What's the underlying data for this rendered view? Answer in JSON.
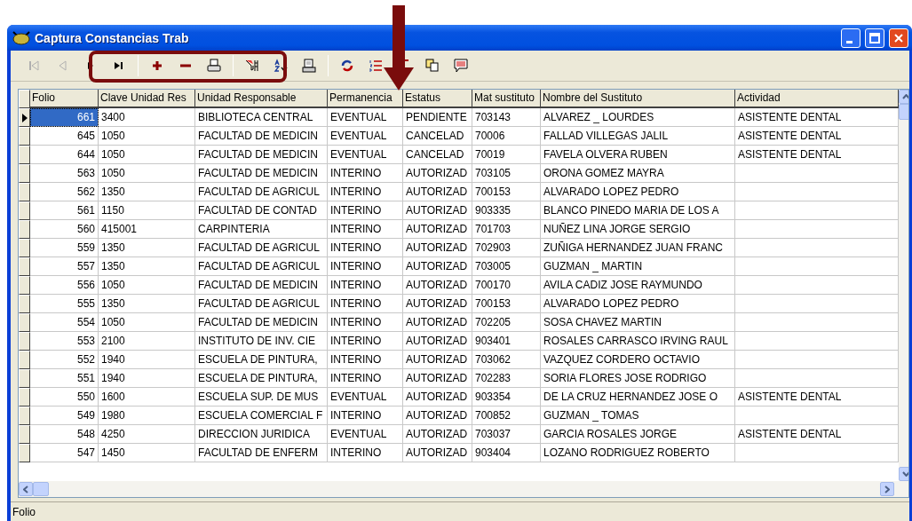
{
  "window": {
    "title": "Captura Constancias Trab"
  },
  "toolbar": [
    {
      "kind": "first",
      "disabled": true
    },
    {
      "kind": "prev",
      "disabled": true
    },
    {
      "kind": "next"
    },
    {
      "kind": "last"
    },
    {
      "kind": "separator"
    },
    {
      "kind": "add"
    },
    {
      "kind": "remove"
    },
    {
      "kind": "print"
    },
    {
      "kind": "separator"
    },
    {
      "kind": "filter"
    },
    {
      "kind": "sort"
    },
    {
      "kind": "preview"
    },
    {
      "kind": "separator"
    },
    {
      "kind": "refresh"
    },
    {
      "kind": "list"
    },
    {
      "kind": "sum"
    },
    {
      "kind": "copy"
    },
    {
      "kind": "comment"
    }
  ],
  "table": {
    "columns": [
      "Folio",
      "Clave Unidad Res",
      "Unidad Responsable",
      "Permanencia",
      "Estatus",
      "Mat sustituto",
      "Nombre del Sustituto",
      "Actividad"
    ],
    "rows": [
      {
        "selected": true,
        "cells": [
          "661",
          "3400",
          "BIBLIOTECA CENTRAL",
          "EVENTUAL",
          "PENDIENTE",
          "703143",
          "ALVAREZ _ LOURDES",
          "ASISTENTE DENTAL"
        ]
      },
      {
        "selected": false,
        "cells": [
          "645",
          "1050",
          "FACULTAD DE MEDICIN",
          "EVENTUAL",
          "CANCELAD",
          "70006",
          "FALLAD VILLEGAS JALIL",
          "ASISTENTE DENTAL"
        ]
      },
      {
        "selected": false,
        "cells": [
          "644",
          "1050",
          "FACULTAD DE MEDICIN",
          "EVENTUAL",
          "CANCELAD",
          "70019",
          "FAVELA OLVERA RUBEN",
          "ASISTENTE DENTAL"
        ]
      },
      {
        "selected": false,
        "cells": [
          "563",
          "1050",
          "FACULTAD DE MEDICIN",
          "INTERINO",
          "AUTORIZAD",
          "703105",
          "ORONA GOMEZ MAYRA"
        ]
      },
      {
        "selected": false,
        "cells": [
          "562",
          "1350",
          "FACULTAD DE AGRICUL",
          "INTERINO",
          "AUTORIZAD",
          "700153",
          "ALVARADO LOPEZ PEDRO"
        ]
      },
      {
        "selected": false,
        "cells": [
          "561",
          "1150",
          "FACULTAD DE CONTAD",
          "INTERINO",
          "AUTORIZAD",
          "903335",
          "BLANCO  PINEDO MARIA DE LOS A"
        ]
      },
      {
        "selected": false,
        "cells": [
          "560",
          "415001",
          "CARPINTERIA",
          "INTERINO",
          "AUTORIZAD",
          "701703",
          "NUÑEZ LINA JORGE SERGIO"
        ]
      },
      {
        "selected": false,
        "cells": [
          "559",
          "1350",
          "FACULTAD DE AGRICUL",
          "INTERINO",
          "AUTORIZAD",
          "702903",
          "ZUÑIGA HERNANDEZ JUAN FRANC"
        ]
      },
      {
        "selected": false,
        "cells": [
          "557",
          "1350",
          "FACULTAD DE AGRICUL",
          "INTERINO",
          "AUTORIZAD",
          "703005",
          "GUZMAN _ MARTIN"
        ]
      },
      {
        "selected": false,
        "cells": [
          "556",
          "1050",
          "FACULTAD DE MEDICIN",
          "INTERINO",
          "AUTORIZAD",
          "700170",
          "AVILA CADIZ JOSE RAYMUNDO"
        ]
      },
      {
        "selected": false,
        "cells": [
          "555",
          "1350",
          "FACULTAD DE AGRICUL",
          "INTERINO",
          "AUTORIZAD",
          "700153",
          "ALVARADO LOPEZ PEDRO"
        ]
      },
      {
        "selected": false,
        "cells": [
          "554",
          "1050",
          "FACULTAD DE MEDICIN",
          "INTERINO",
          "AUTORIZAD",
          "702205",
          "SOSA CHAVEZ MARTIN"
        ]
      },
      {
        "selected": false,
        "cells": [
          "553",
          "2100",
          "INSTITUTO DE INV. CIE",
          "INTERINO",
          "AUTORIZAD",
          "903401",
          "ROSALES CARRASCO IRVING RAUL"
        ]
      },
      {
        "selected": false,
        "cells": [
          "552",
          "1940",
          "ESCUELA DE PINTURA,",
          "INTERINO",
          "AUTORIZAD",
          "703062",
          "VAZQUEZ CORDERO OCTAVIO"
        ]
      },
      {
        "selected": false,
        "cells": [
          "551",
          "1940",
          "ESCUELA DE PINTURA,",
          "INTERINO",
          "AUTORIZAD",
          "702283",
          "SORIA FLORES JOSE RODRIGO"
        ]
      },
      {
        "selected": false,
        "cells": [
          "550",
          "1600",
          "ESCUELA SUP. DE MUS",
          "EVENTUAL",
          "AUTORIZAD",
          "903354",
          "DE LA CRUZ  HERNANDEZ JOSE O",
          "ASISTENTE DENTAL"
        ]
      },
      {
        "selected": false,
        "cells": [
          "549",
          "1980",
          "ESCUELA COMERCIAL F",
          "INTERINO",
          "AUTORIZAD",
          "700852",
          "GUZMAN _ TOMAS"
        ]
      },
      {
        "selected": false,
        "cells": [
          "548",
          "4250",
          "DIRECCION JURIDICA",
          "EVENTUAL",
          "AUTORIZAD",
          "703037",
          "GARCIA ROSALES JORGE",
          "ASISTENTE DENTAL"
        ]
      },
      {
        "selected": false,
        "cells": [
          "547",
          "1450",
          "FACULTAD DE ENFERM",
          "INTERINO",
          "AUTORIZAD",
          "903404",
          "LOZANO RODRIGUEZ ROBERTO"
        ]
      }
    ]
  },
  "status_bar": "Folio"
}
